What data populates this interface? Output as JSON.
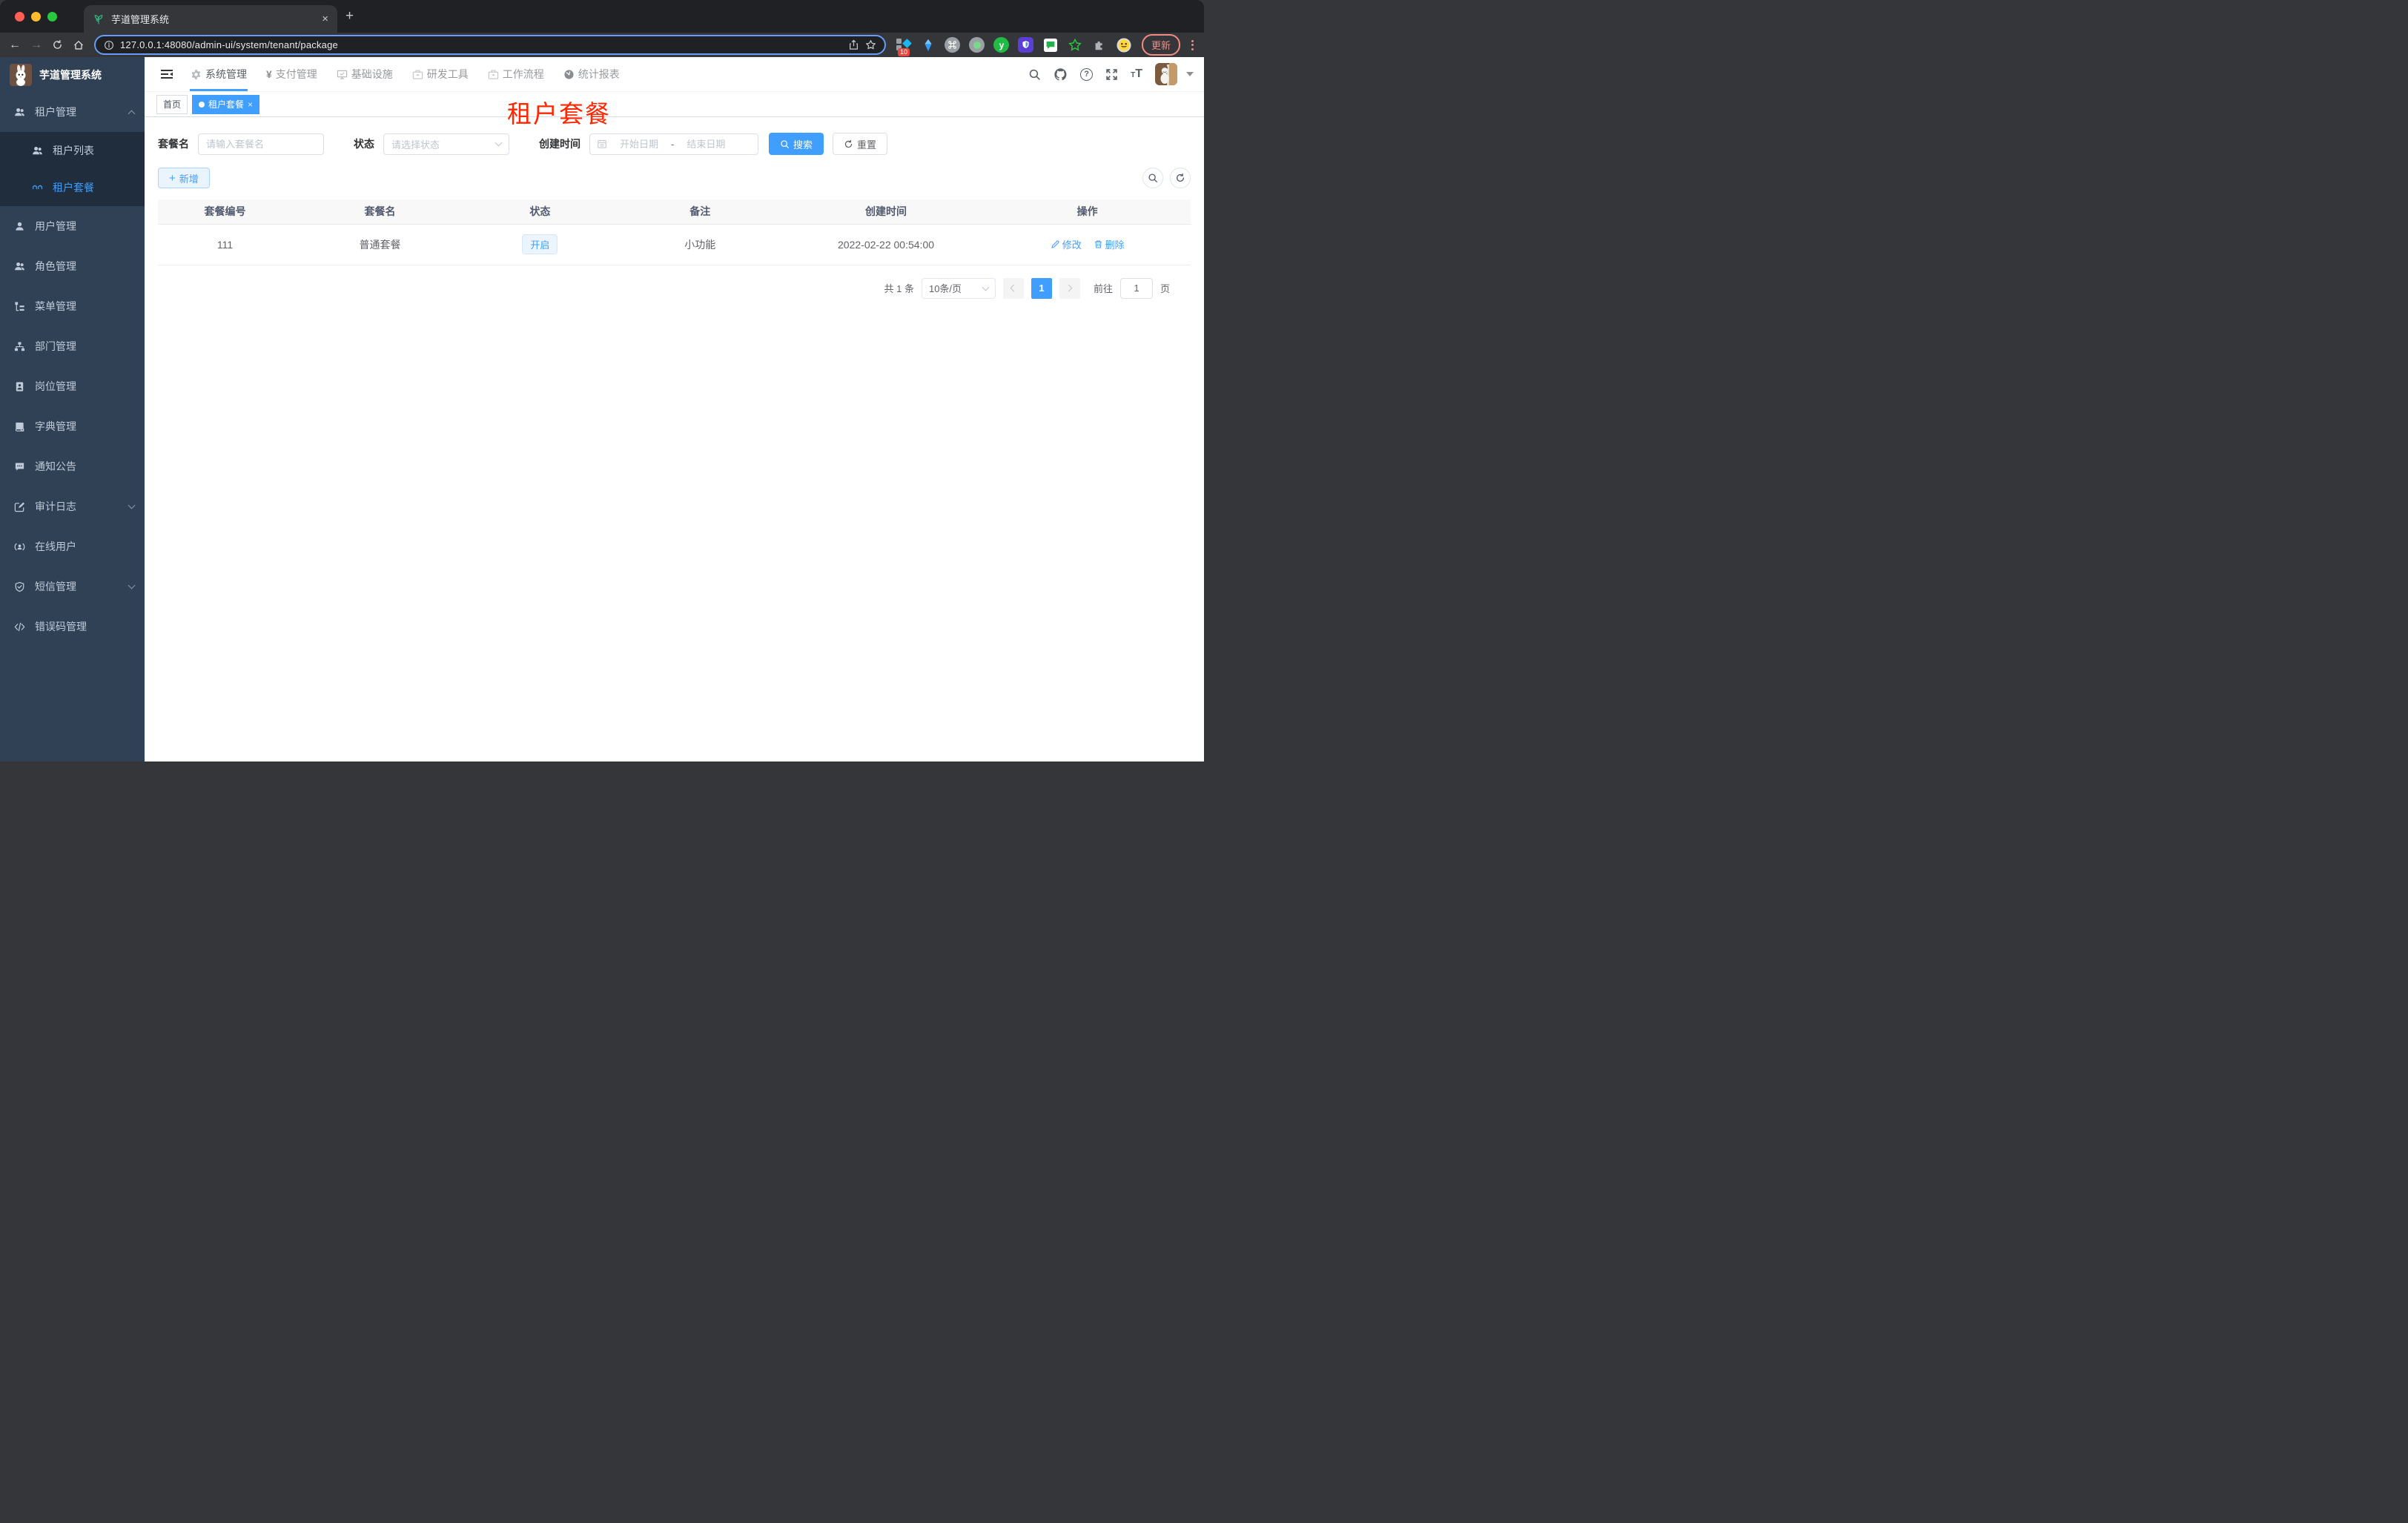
{
  "browser": {
    "tab_title": "芋道管理系统",
    "url": "127.0.0.1:48080/admin-ui/system/tenant/package",
    "update_button": "更新",
    "extension_badge": "10"
  },
  "glyphs": {
    "close": "×",
    "plus": "+",
    "back": "←",
    "forward": "→",
    "yen": "¥",
    "help": "?",
    "font_small": "T",
    "font_large": "T"
  },
  "sidebar": {
    "logo_title": "芋道管理系统",
    "items": [
      {
        "label": "租户管理",
        "icon": "users-icon",
        "state": "expanded"
      },
      {
        "label": "租户列表",
        "icon": "users-icon",
        "submenu": true
      },
      {
        "label": "租户套餐",
        "icon": "glasses-icon",
        "submenu": true,
        "active": true
      },
      {
        "label": "用户管理",
        "icon": "user-icon"
      },
      {
        "label": "角色管理",
        "icon": "users-icon"
      },
      {
        "label": "菜单管理",
        "icon": "menu-tree-icon"
      },
      {
        "label": "部门管理",
        "icon": "org-tree-icon"
      },
      {
        "label": "岗位管理",
        "icon": "badge-icon"
      },
      {
        "label": "字典管理",
        "icon": "dictionary-icon"
      },
      {
        "label": "通知公告",
        "icon": "announcement-icon"
      },
      {
        "label": "审计日志",
        "icon": "audit-log-icon",
        "state": "collapsed"
      },
      {
        "label": "在线用户",
        "icon": "online-user-icon"
      },
      {
        "label": "短信管理",
        "icon": "sms-shield-icon",
        "state": "collapsed"
      },
      {
        "label": "错误码管理",
        "icon": "error-code-icon"
      }
    ]
  },
  "header": {
    "nav": [
      {
        "label": "系统管理",
        "icon": "gear-icon",
        "active": true
      },
      {
        "label": "支付管理",
        "icon": "yen-icon"
      },
      {
        "label": "基础设施",
        "icon": "monitor-icon"
      },
      {
        "label": "研发工具",
        "icon": "briefcase-icon"
      },
      {
        "label": "工作流程",
        "icon": "briefcase-icon"
      },
      {
        "label": "统计报表",
        "icon": "dashboard-icon"
      }
    ]
  },
  "tags": {
    "home": "首页",
    "current": "租户套餐"
  },
  "overlay_title": "租户套餐",
  "filter": {
    "name_label": "套餐名",
    "name_placeholder": "请输入套餐名",
    "status_label": "状态",
    "status_placeholder": "请选择状态",
    "time_label": "创建时间",
    "start_placeholder": "开始日期",
    "separator": "-",
    "end_placeholder": "结束日期",
    "search_button": "搜索",
    "reset_button": "重置"
  },
  "toolbar": {
    "add_button": "新增"
  },
  "table": {
    "columns": [
      "套餐编号",
      "套餐名",
      "状态",
      "备注",
      "创建时间",
      "操作"
    ],
    "rows": [
      {
        "id": "111",
        "name": "普通套餐",
        "status": "开启",
        "remark": "小功能",
        "created": "2022-02-22 00:54:00",
        "edit": "修改",
        "delete": "删除"
      }
    ]
  },
  "pagination": {
    "total": "共 1 条",
    "page_size": "10条/页",
    "current_page": "1",
    "goto_label": "前往",
    "goto_value": "1",
    "page_unit": "页"
  },
  "colors": {
    "accent": "#409eff",
    "overlay_red": "#ff2600",
    "sidebar_bg": "#304156",
    "submenu_bg": "#1f2d3d",
    "status_tag_bg": "#ecf5ff",
    "table_header_bg": "#f8f8f9"
  }
}
